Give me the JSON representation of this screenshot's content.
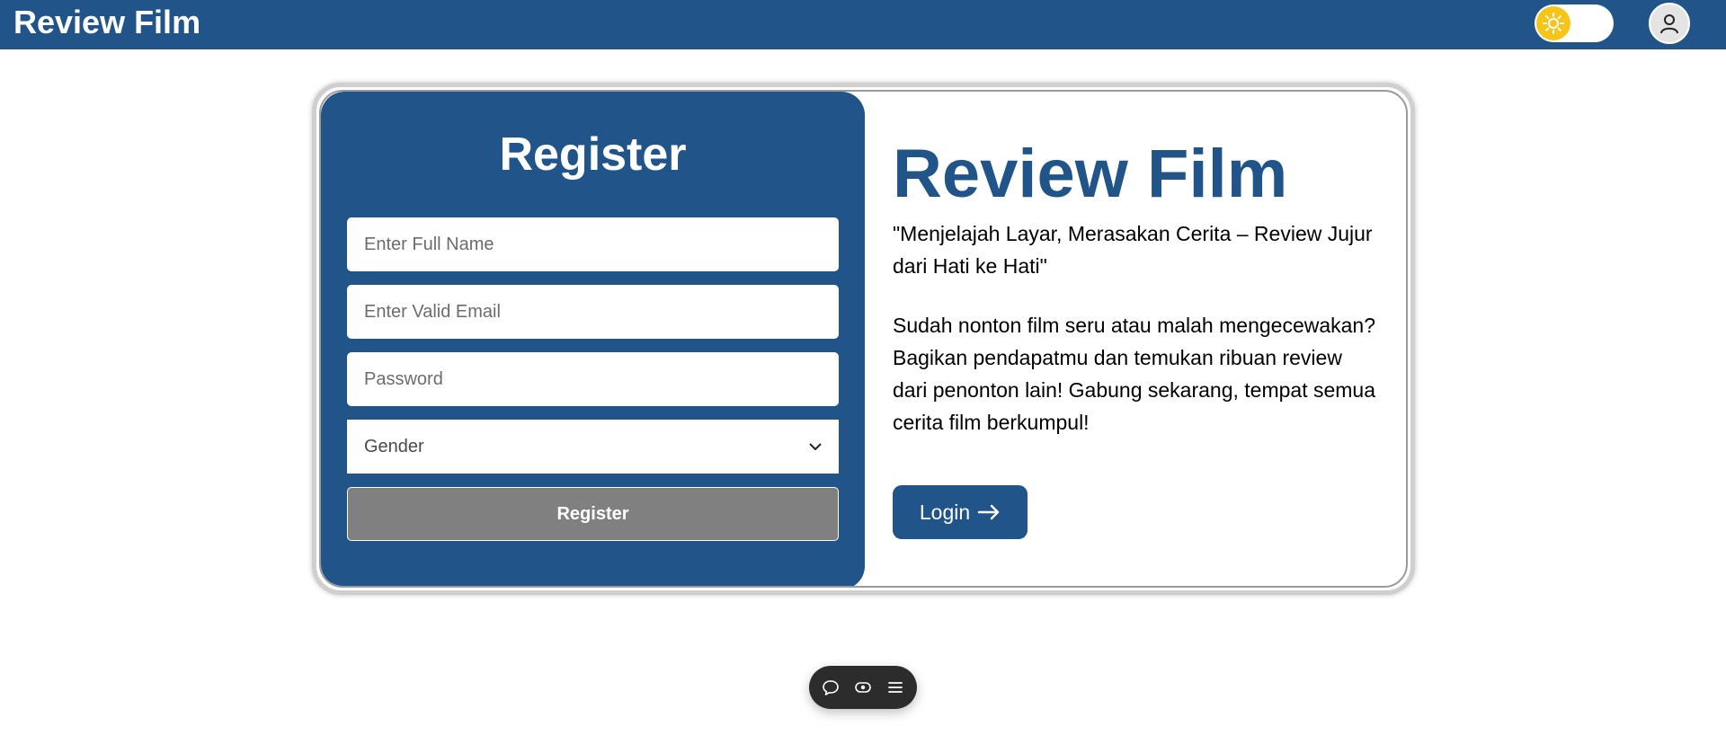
{
  "navbar": {
    "brand": "Review Film",
    "theme_icon": "sun-icon",
    "avatar_icon": "user-icon"
  },
  "register_form": {
    "title": "Register",
    "full_name_placeholder": "Enter Full Name",
    "email_placeholder": "Enter Valid Email",
    "password_placeholder": "Password",
    "gender_selected": "Gender",
    "submit_label": "Register"
  },
  "info": {
    "title": "Review Film",
    "tagline": "\"Menjelajah Layar, Merasakan Cerita – Review Jujur dari Hati ke Hati\"",
    "description": "Sudah nonton film seru atau malah mengecewakan? Bagikan pendapatmu dan temukan ribuan review dari penonton lain! Gabung sekarang, tempat semua cerita film berkumpul!",
    "login_label": "Login"
  },
  "toolbar": {
    "icons": [
      "comment-icon",
      "eye-icon",
      "menu-icon"
    ]
  },
  "colors": {
    "primary": "#215589",
    "button_disabled": "#808080",
    "sun": "#f5c518",
    "toolbar_bg": "#2c2c2c"
  }
}
